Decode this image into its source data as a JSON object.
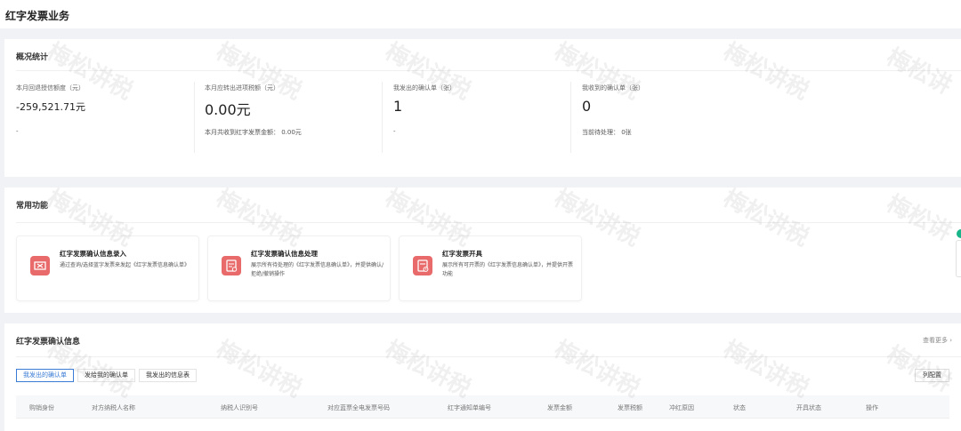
{
  "page": {
    "title": "红字发票业务"
  },
  "overview": {
    "title": "概况统计",
    "stats": [
      {
        "label": "本月回退授信额度（元）",
        "value": "-259,521.71元",
        "sub": "-"
      },
      {
        "label": "本月应转出进项税额（元）",
        "value": "0.00元",
        "sub": "本月共收到红字发票金额：  0.00元"
      },
      {
        "label": "我发出的确认单（张）",
        "value": "1",
        "sub": "-"
      },
      {
        "label": "我收到的确认单（张）",
        "value": "0",
        "sub": "当前待处理：  0张"
      }
    ]
  },
  "functions": {
    "title": "常用功能",
    "items": [
      {
        "title": "红字发票确认信息录入",
        "desc": "通过查询/选择蓝字发票来发起《红字发票信息确认单》"
      },
      {
        "title": "红字发票确认信息处理",
        "desc": "展示所有待处理的《红字发票信息确认单》，并提供确认/拒绝/撤销操作"
      },
      {
        "title": "红字发票开具",
        "desc": "展示所有可开票的《红字发票信息确认单》，并提供开票功能"
      }
    ]
  },
  "info": {
    "title": "红字发票确认信息",
    "view_more": "查看更多 ›",
    "tabs": [
      "我发出的确认单",
      "发给我的确认单",
      "我发出的信息表"
    ],
    "active_tab": 0,
    "config_button": "列配置",
    "columns": [
      "购销身份",
      "对方纳税人名称",
      "纳税人识别号",
      "对应蓝票全电发票号码",
      "红字通知单编号",
      "发票金额",
      "发票税额",
      "冲红原因",
      "状态",
      "开具状态",
      "操作"
    ]
  },
  "watermark": {
    "text": "梅松讲税"
  },
  "colors": {
    "accent": "#3a7bd5",
    "icon_red": "#e86a6a",
    "float_green": "#18b58a"
  }
}
